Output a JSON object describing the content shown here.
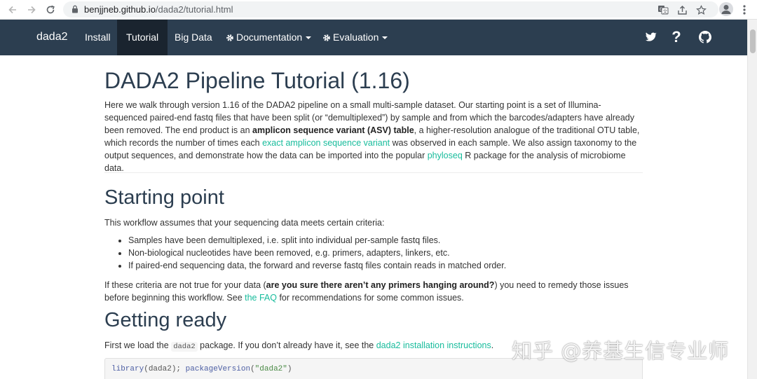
{
  "browser": {
    "url_host": "benjjneb.github.io",
    "url_path": "/dada2/tutorial.html"
  },
  "navbar": {
    "brand": "dada2",
    "items": [
      {
        "label": "Install"
      },
      {
        "label": "Tutorial",
        "active": true
      },
      {
        "label": "Big Data"
      },
      {
        "label": "Documentation",
        "dropdown": true
      },
      {
        "label": "Evaluation",
        "dropdown": true
      }
    ],
    "right_icons": [
      "twitter-icon",
      "help-icon",
      "github-icon"
    ]
  },
  "page": {
    "title": "DADA2 Pipeline Tutorial (1.16)",
    "intro": {
      "t1": "Here we walk through version 1.16 of the DADA2 pipeline on a small multi-sample dataset. Our starting point is a set of Illumina-sequenced paired-end fastq files that have been split (or “demultiplexed”) by sample and from which the barcodes/adapters have already been removed. The end product is an ",
      "b1": "amplicon sequence variant (ASV) table",
      "t2": ", a higher-resolution analogue of the traditional OTU table, which records the number of times each ",
      "link1": "exact amplicon sequence variant",
      "t3": " was observed in each sample. We also assign taxonomy to the output sequences, and demonstrate how the data can be imported into the popular ",
      "link2": "phyloseq",
      "t4": " R package for the analysis of microbiome data."
    },
    "starting_point": {
      "heading": "Starting point",
      "lead": "This workflow assumes that your sequencing data meets certain criteria:",
      "criteria": [
        "Samples have been demultiplexed, i.e. split into individual per-sample fastq files.",
        "Non-biological nucleotides have been removed, e.g. primers, adapters, linkers, etc.",
        "If paired-end sequencing data, the forward and reverse fastq files contain reads in matched order."
      ],
      "p2_t1": "If these criteria are not true for your data (",
      "p2_b": "are you sure there aren’t any primers hanging around?",
      "p2_t2": ") you need to remedy those issues before beginning this workflow. See ",
      "p2_link": "the FAQ",
      "p2_t3": " for recommendations for some common issues."
    },
    "getting_ready": {
      "heading": "Getting ready",
      "t1": "First we load the ",
      "code": "dada2",
      "t2": " package. If you don’t already have it, see the ",
      "link": "dada2 installation instructions",
      "t3": ".",
      "code_fn1": "library",
      "code_arg1": "(dada2); ",
      "code_fn2": "packageVersion",
      "code_arg2a": "(",
      "code_str": "\"dada2\"",
      "code_arg2b": ")"
    }
  },
  "watermark": "知乎 @养基生信专业师"
}
